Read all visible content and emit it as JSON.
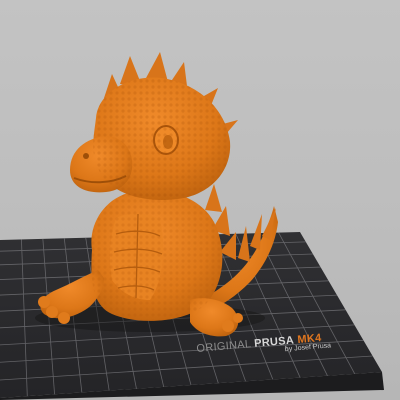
{
  "bed": {
    "brand_prefix": "ORIGINAL",
    "brand_name": "PRUSA",
    "brand_model": "MK4",
    "maker": "by Josef Prusa"
  },
  "colors": {
    "background": "#bfbfbf",
    "bed_surface": "#2a2a2c",
    "bed_grid": "#7c7c80",
    "model": "#e07b1c",
    "brand_accent": "#e0761f"
  },
  "model": {
    "icon": "dragon-model-icon"
  }
}
